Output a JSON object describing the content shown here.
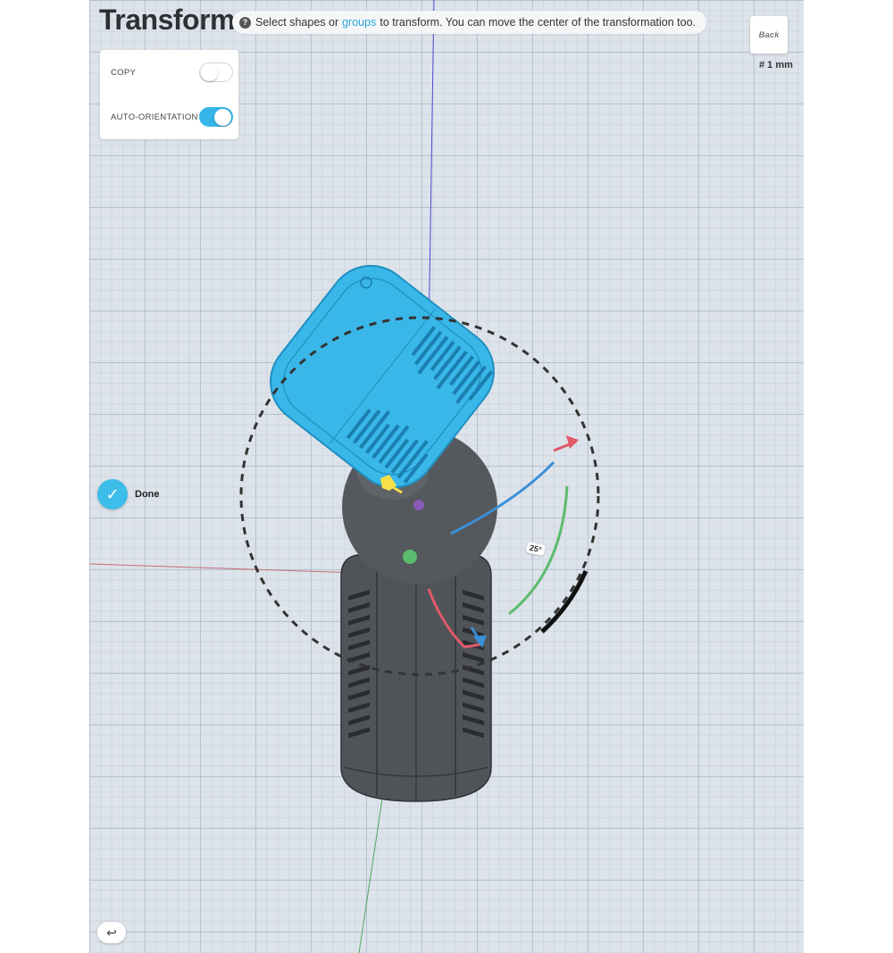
{
  "page": {
    "title": "Transform"
  },
  "hint": {
    "icon": "question-icon",
    "text_before": "Select shapes or",
    "link": "groups",
    "text_after": "to transform. You can move the center of the transformation too."
  },
  "options": {
    "copy": {
      "label": "COPY",
      "on": false
    },
    "auto_orientation": {
      "label": "AUTO-ORIENTATION",
      "on": true
    }
  },
  "view_cube": {
    "label": "Back"
  },
  "grid": {
    "scale": "# 1 mm"
  },
  "done": {
    "label": "Done",
    "icon": "checkmark-icon"
  },
  "rotation": {
    "angle_label": "25°"
  },
  "undo": {
    "icon": "undo-icon"
  },
  "colors": {
    "accent": "#36b6e8",
    "selected_shape": "#39b7e8",
    "model": "#505459",
    "axis_red": "#e05a6a",
    "axis_green": "#5cbb6e",
    "axis_blue": "#3a8fd6",
    "yellow_handle": "#f5e04a",
    "purple_handle": "#8a5cb8"
  }
}
